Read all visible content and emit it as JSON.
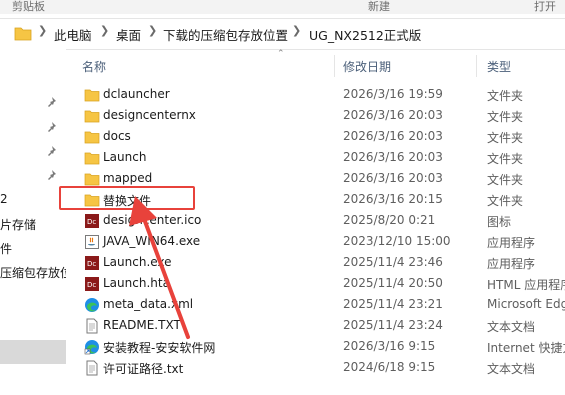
{
  "ribbon": {
    "left_label": "剪贴板",
    "mid_label": "新建",
    "right_label": "打开"
  },
  "breadcrumb": [
    "此电脑",
    "桌面",
    "下载的压缩包存放位置",
    "UG_NX2512正式版"
  ],
  "columns": {
    "name": "名称",
    "date": "修改日期",
    "type": "类型"
  },
  "nav": [
    {
      "label": "2"
    },
    {
      "label": "片存储"
    },
    {
      "label": "件"
    },
    {
      "label": "压缩包存放位"
    }
  ],
  "files": [
    {
      "name": "dclauncher",
      "date": "2026/3/16 19:59",
      "type": "文件夹",
      "icon": "folder-icon"
    },
    {
      "name": "designcenternx",
      "date": "2026/3/16 20:03",
      "type": "文件夹",
      "icon": "folder-icon"
    },
    {
      "name": "docs",
      "date": "2026/3/16 20:03",
      "type": "文件夹",
      "icon": "folder-icon"
    },
    {
      "name": "Launch",
      "date": "2026/3/16 20:03",
      "type": "文件夹",
      "icon": "folder-icon"
    },
    {
      "name": "mapped",
      "date": "2026/3/16 20:03",
      "type": "文件夹",
      "icon": "folder-icon"
    },
    {
      "name": "替换文件",
      "date": "2026/3/16 20:15",
      "type": "文件夹",
      "icon": "folder-icon"
    },
    {
      "name": "designcenter.ico",
      "date": "2025/8/20 0:21",
      "type": "图标",
      "icon": "dc-app-icon"
    },
    {
      "name": "JAVA_WIN64.exe",
      "date": "2023/12/10 15:00",
      "type": "应用程序",
      "icon": "java-exe-icon"
    },
    {
      "name": "Launch.exe",
      "date": "2025/11/4 23:46",
      "type": "应用程序",
      "icon": "dc-app-icon"
    },
    {
      "name": "Launch.hta",
      "date": "2025/11/4 20:50",
      "type": "HTML 应用程序",
      "icon": "dc-app-icon"
    },
    {
      "name": "meta_data.xml",
      "date": "2025/11/4 23:21",
      "type": "Microsoft Edge",
      "icon": "edge-icon"
    },
    {
      "name": "README.TXT",
      "date": "2025/11/4 23:24",
      "type": "文本文档",
      "icon": "text-file-icon"
    },
    {
      "name": "安装教程-安安软件网",
      "date": "2026/3/16 9:15",
      "type": "Internet 快捷方",
      "icon": "edge-shortcut-icon"
    },
    {
      "name": "许可证路径.txt",
      "date": "2024/6/18 9:15",
      "type": "文本文档",
      "icon": "text-file-icon"
    }
  ],
  "annotation_color": "#e8423b",
  "folder_color": "#f6c544"
}
